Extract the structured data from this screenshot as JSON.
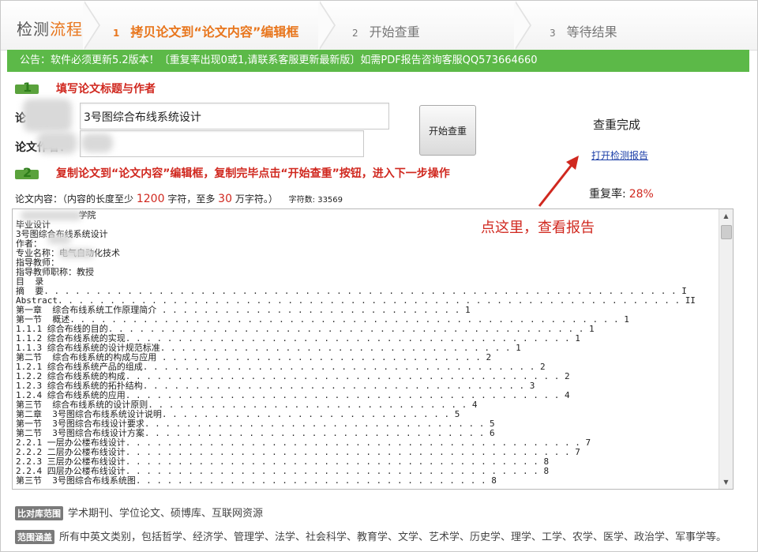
{
  "header": {
    "title_part1": "检测",
    "title_part2": "流程",
    "steps": [
      {
        "num": "1",
        "label": "拷贝论文到“论文内容”编辑框"
      },
      {
        "num": "2",
        "label": "开始查重"
      },
      {
        "num": "3",
        "label": "等待结果"
      }
    ]
  },
  "notice": "公告：软件必须更新5.2版本！〔重复率出现0或1,请联系客服更新最新版〕如需PDF报告咨询客服QQ573664660",
  "section1": {
    "badge": "1",
    "title": "填写论文标题与作者",
    "title_field_label": "论",
    "title_value": "3号图综合布线系统设计",
    "author_field_label": "论文作者：",
    "author_value": ""
  },
  "start_button": "开始查重",
  "result": {
    "status": "查重完成",
    "report_link": "打开检测报告",
    "rate_label": "重复率:",
    "rate_value": "28%"
  },
  "section2": {
    "badge": "2",
    "title": "复制论文到“论文内容”编辑框，复制完毕点击“开始查重”按钮，进入下一步操作"
  },
  "content_label": {
    "prefix": "论文内容：（内容的长度至少",
    "min": "1200",
    "mid": "字符，至多",
    "max": "30",
    "suffix": "万字符。）",
    "count_label": "字符数: 33569"
  },
  "hint": "点这里，查看报告",
  "content_lines": [
    "            学院",
    "毕业设计",
    "3号图综合布线系统设计",
    "作者：",
    "专业名称：电气自动化技术",
    "指导教师：",
    "指导教师职称：教授",
    "目  录",
    "摘  要. . . . . . . . . . . . . . . . . . . . . . . . . . . . . . . . . . . . . . . . . . . . . . . . . . . . . . . . . . . . . I",
    "Abstract. . . . . . . . . . . . . . . . . . . . . . . . . . . . . . . . . . . . . . . . . . . . . . . . . . . . . . . . . . . . II",
    "第一章  综合布线系统工作原理简介 . . . . . . . . . . . . . . . . . . . . . . . . . . . . . 1",
    "第一节  概述. . . . . . . . . . . . . . . . . . . . . . . . . . . . . . . . . . . . . . . . . . . . . . . . . . . . . 1",
    "1.1.1 综合布线的目的. . . . . . . . . . . . . . . . . . . . . . . . . . . . . . . . . . . . . . . . . . . . . . 1",
    "1.1.2 综合布线系统的实现. . . . . . . . . . . . . . . . . . . . . . . . . . . . . . . . . . . . . . . . . . . 1",
    "1.1.3 综合布线系统的设计规范标准. . . . . . . . . . . . . . . . . . . . . . . . . . . . . . . . . . 1",
    "第二节  综合布线系统的构成与应用 . . . . . . . . . . . . . . . . . . . . . . . . . . . . . . . 2",
    "1.2.1 综合布线系统产品的组成. . . . . . . . . . . . . . . . . . . . . . . . . . . . . . . . . . . . . . 2",
    "1.2.2 综合布线系统的构成. . . . . . . . . . . . . . . . . . . . . . . . . . . . . . . . . . . . . . . . . . 2",
    "1.2.3 综合布线系统的拓扑结构. . . . . . . . . . . . . . . . . . . . . . . . . . . . . . . . . . . . . 3",
    "1.2.4 综合布线系统的应用. . . . . . . . . . . . . . . . . . . . . . . . . . . . . . . . . . . . . . . . . . 4",
    "第三节  综合布线系统的设计原则. . . . . . . . . . . . . . . . . . . . . . . . . . . . . . . 4",
    "第二章  3号图综合布线系统设计说明. . . . . . . . . . . . . . . . . . . . . . . . . . . . 5",
    "第一节  3号图综合布线设计要求. . . . . . . . . . . . . . . . . . . . . . . . . . . . . . . . . 5",
    "第二节  3号图综合布线设计方案. . . . . . . . . . . . . . . . . . . . . . . . . . . . . . . . . 6",
    "2.2.1 一层办公楼布线设计. . . . . . . . . . . . . . . . . . . . . . . . . . . . . . . . . . . . . . . . . . . . 7",
    "2.2.2 二层办公楼布线设计. . . . . . . . . . . . . . . . . . . . . . . . . . . . . . . . . . . . . . . . . . . 7",
    "2.2.3 三层办公楼布线设计. . . . . . . . . . . . . . . . . . . . . . . . . . . . . . . . . . . . . . . . 8",
    "2.2.4 四层办公楼布线设计. . . . . . . . . . . . . . . . . . . . . . . . . . . . . . . . . . . . . . . . 8",
    "第三节  3号图综合布线系统图. . . . . . . . . . . . . . . . . . . . . . . . . . . . . . . . . . 8"
  ],
  "footer": {
    "scope_tag": "比对库范围",
    "scope_text": "学术期刊、学位论文、硕博库、互联网资源",
    "range_tag": "范围涵盖",
    "range_text": "所有中英文类别，包括哲学、经济学、管理学、法学、社会科学、教育学、文学、艺术学、历史学、理学、工学、农学、医学、政治学、军事学等。"
  },
  "colors": {
    "accent_orange": "#e8761d",
    "notice_green": "#5cb948",
    "alert_red": "#d0281f",
    "link_blue": "#1c3fa8"
  }
}
